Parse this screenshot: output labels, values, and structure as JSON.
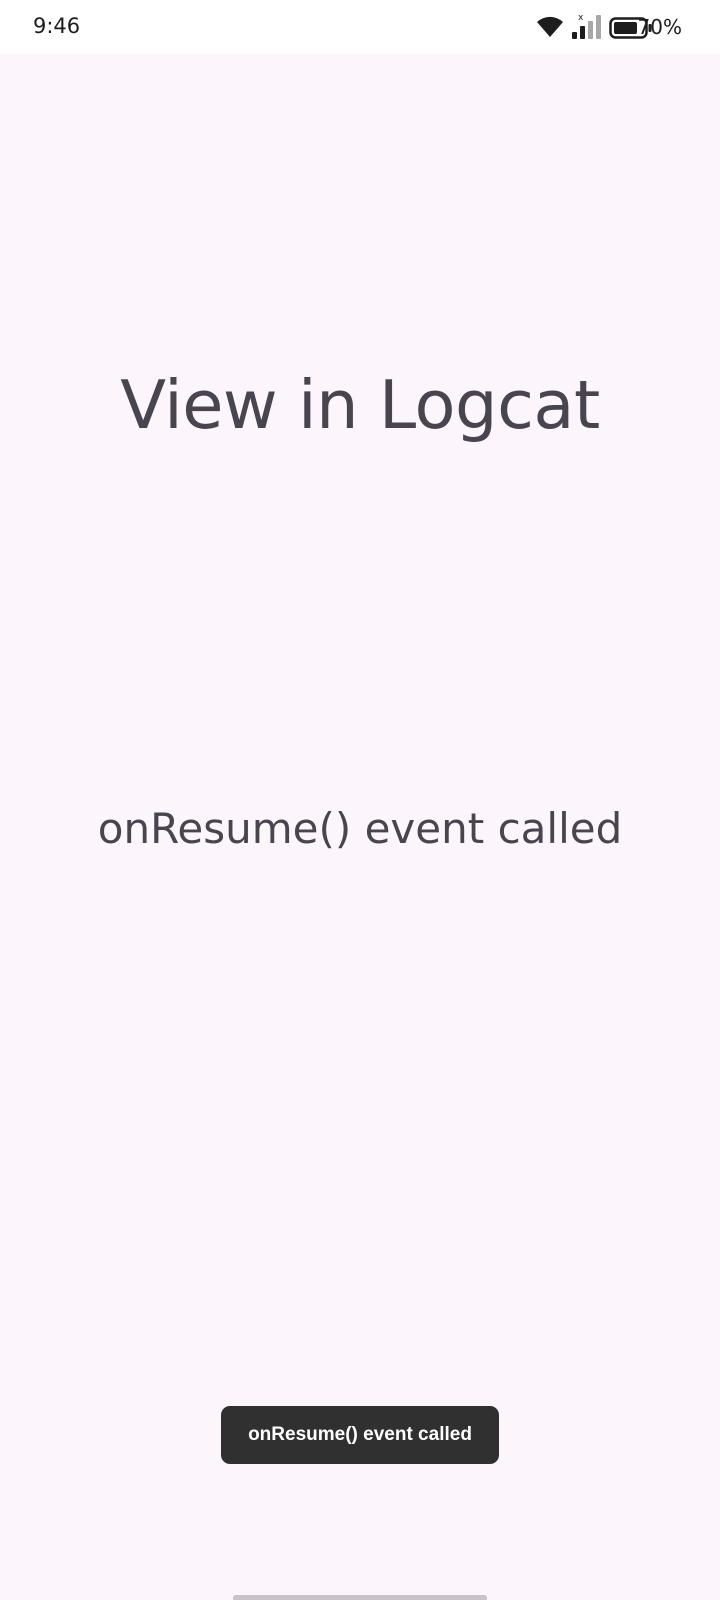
{
  "status_bar": {
    "time": "9:46",
    "battery_percent": "70%",
    "battery_level": 0.7,
    "icons": [
      "wifi-icon",
      "signal-icon",
      "battery-icon"
    ]
  },
  "main": {
    "heading": "View in Logcat",
    "event_text": "onResume() event called"
  },
  "toast": {
    "message": "onResume() event called"
  },
  "colors": {
    "background": "#fcf5fc",
    "text": "#49454f",
    "toast_bg": "#303030"
  }
}
